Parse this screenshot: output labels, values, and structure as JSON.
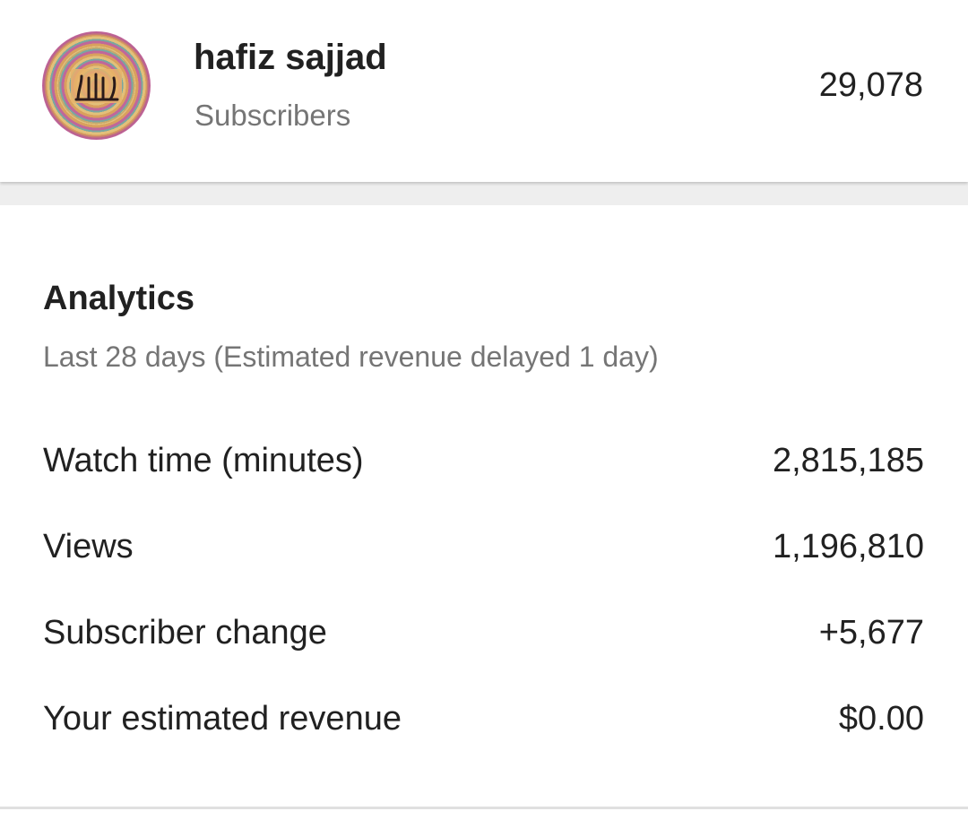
{
  "channel": {
    "name": "hafiz sajjad",
    "subscribers_label": "Subscribers",
    "subscribers_count": "29,078",
    "avatar_icon": "calligraphy-avatar-icon"
  },
  "analytics": {
    "title": "Analytics",
    "subtitle": "Last 28 days (Estimated revenue delayed 1 day)",
    "metrics": [
      {
        "label": "Watch time (minutes)",
        "value": "2,815,185"
      },
      {
        "label": "Views",
        "value": "1,196,810"
      },
      {
        "label": "Subscriber change",
        "value": "+5,677"
      },
      {
        "label": "Your estimated revenue",
        "value": "$0.00"
      }
    ]
  },
  "colors": {
    "primary_text": "#212121",
    "secondary_text": "#757575",
    "separator": "#eeeeee"
  }
}
